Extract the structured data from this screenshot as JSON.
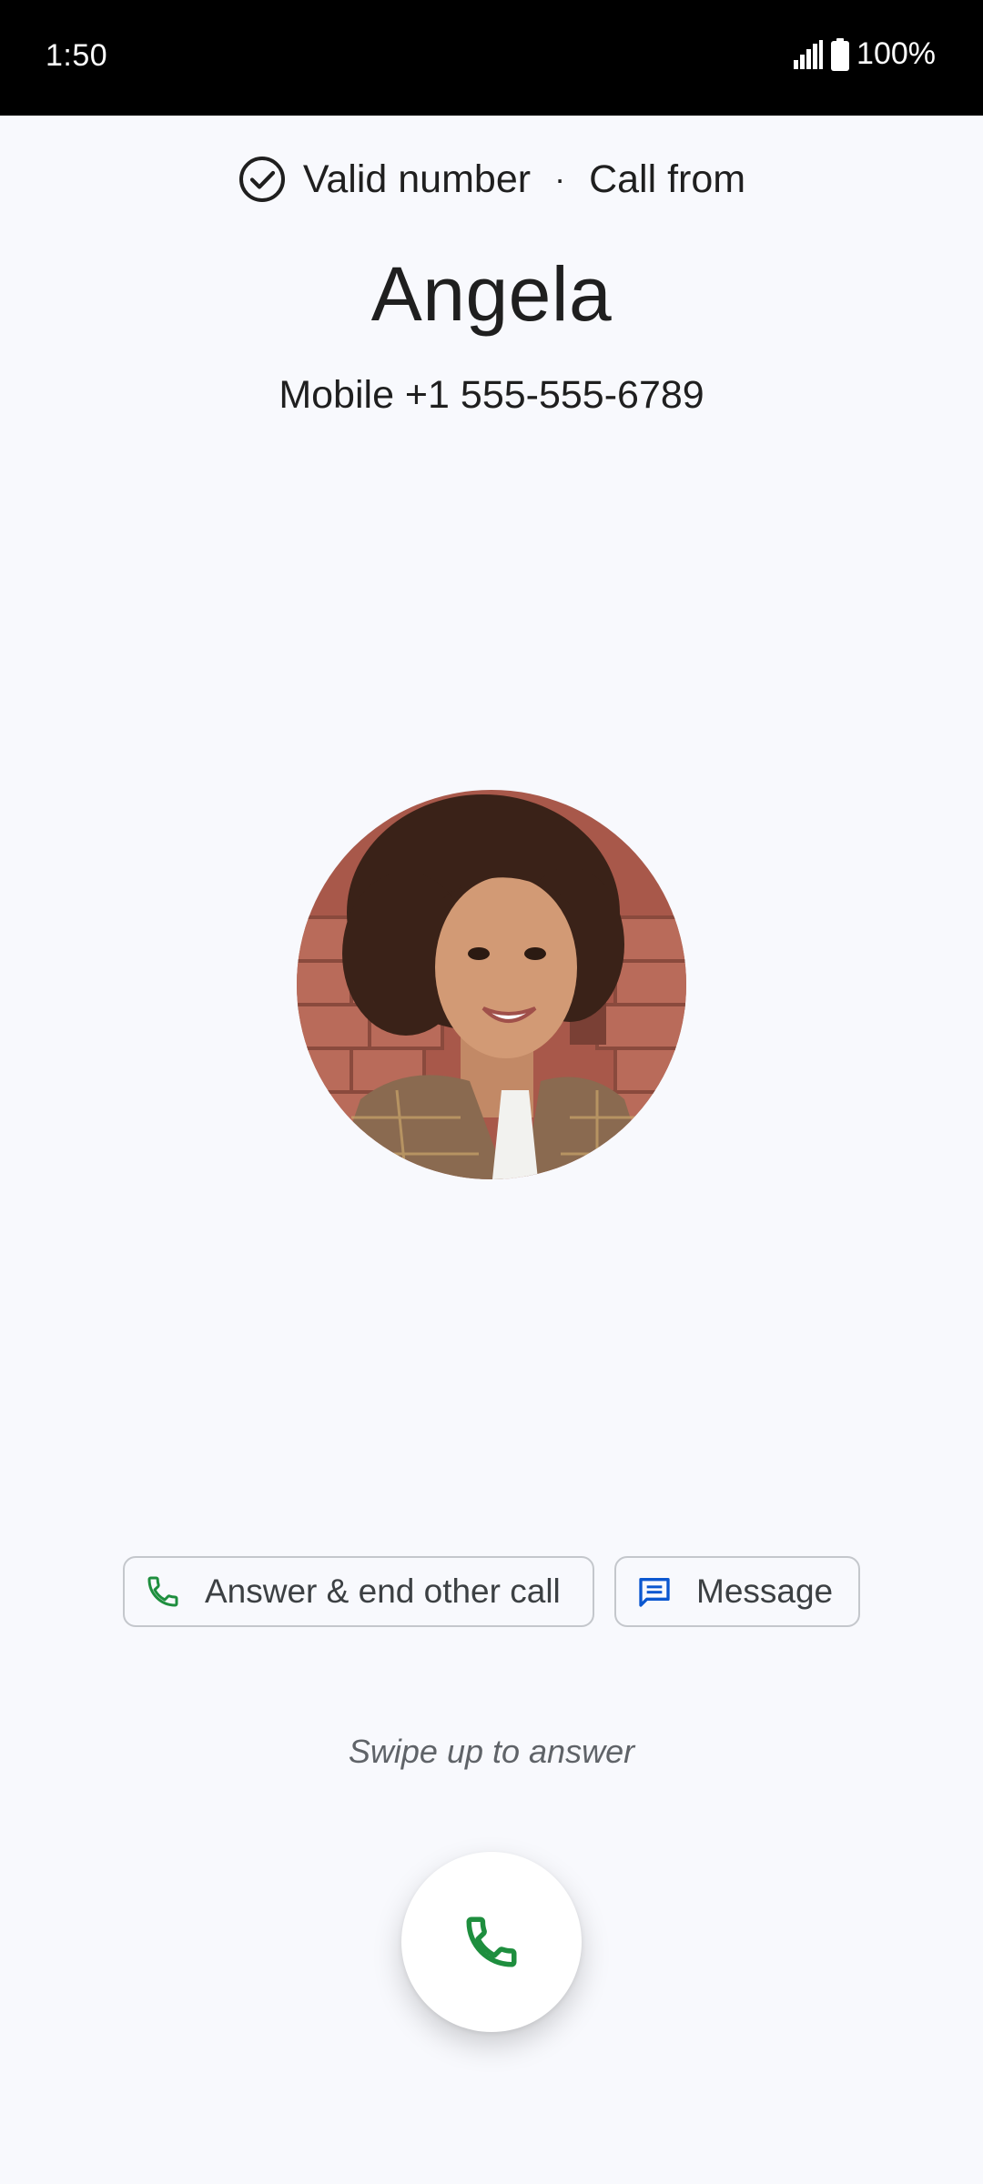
{
  "status_bar": {
    "time": "1:50",
    "battery": "100%",
    "icons": [
      "signal-icon",
      "battery-icon"
    ]
  },
  "header": {
    "verification": "Valid number",
    "separator": "·",
    "label": "Call from",
    "icon": "check-circle-icon"
  },
  "caller": {
    "name": "Angela",
    "number": "Mobile +1 555-555-6789"
  },
  "actions": {
    "answer_end": {
      "label": "Answer & end other call",
      "icon": "phone-icon",
      "icon_color": "#1e8e3e"
    },
    "message": {
      "label": "Message",
      "icon": "message-icon",
      "icon_color": "#0b57d0"
    }
  },
  "swipe_hint": "Swipe up to answer",
  "answer_button": {
    "icon": "phone-icon",
    "color": "#1e8e3e"
  }
}
